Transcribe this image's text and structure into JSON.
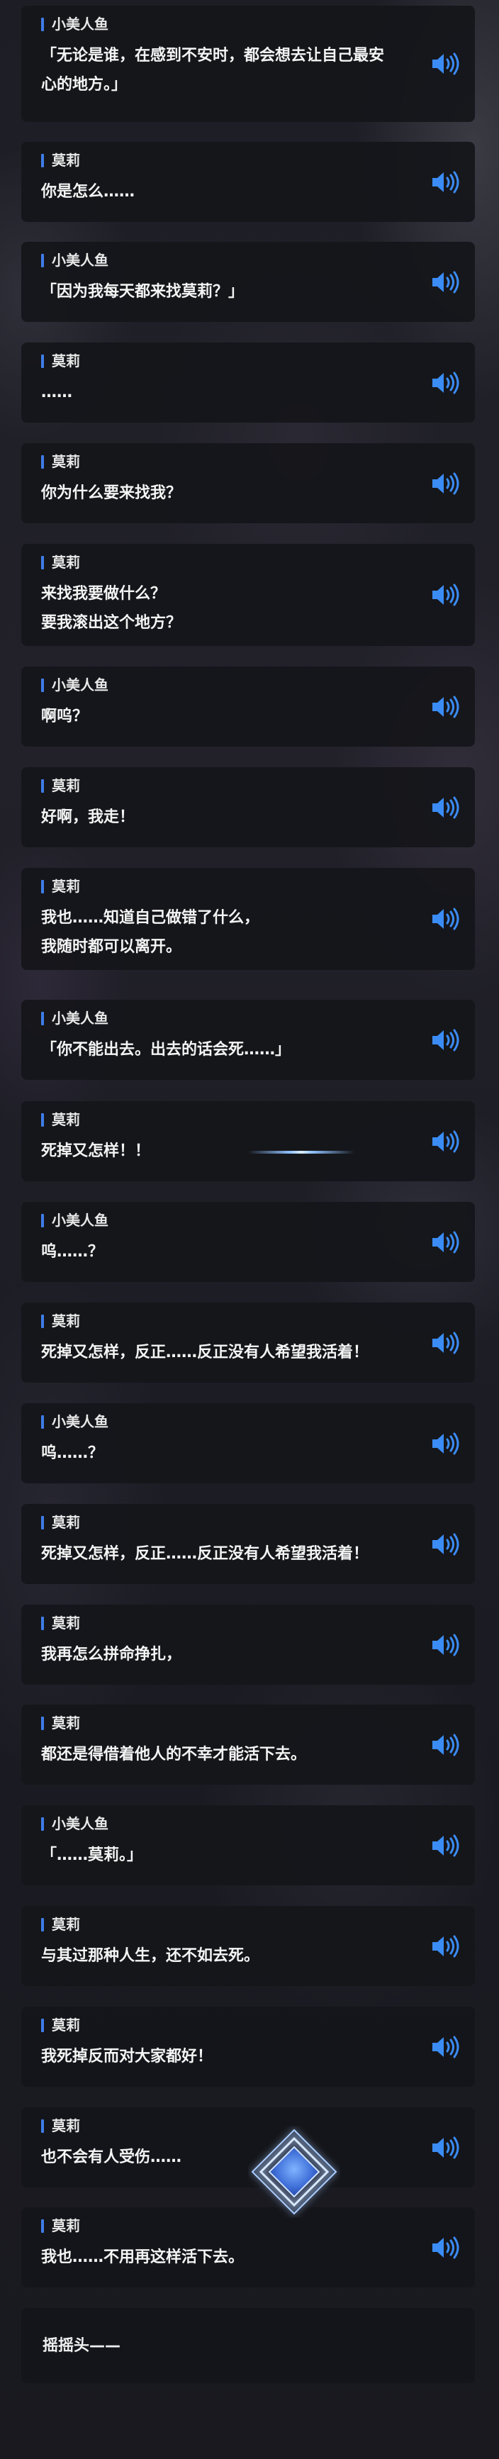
{
  "dialogue": [
    {
      "speaker": "小美人鱼",
      "lines": [
        "「无论是谁，在感到不安时，都会想去让自己最安",
        "心的地方。」"
      ]
    },
    {
      "speaker": "莫莉",
      "lines": [
        "你是怎么……"
      ]
    },
    {
      "speaker": "小美人鱼",
      "lines": [
        "「因为我每天都来找莫莉？」"
      ]
    },
    {
      "speaker": "莫莉",
      "lines": [
        "……"
      ]
    },
    {
      "speaker": "莫莉",
      "lines": [
        "你为什么要来找我？"
      ]
    },
    {
      "speaker": "莫莉",
      "lines": [
        "来找我要做什么？",
        "要我滚出这个地方？"
      ]
    },
    {
      "speaker": "小美人鱼",
      "lines": [
        "啊呜？"
      ]
    },
    {
      "speaker": "莫莉",
      "lines": [
        "好啊，我走！"
      ]
    },
    {
      "speaker": "莫莉",
      "lines": [
        "我也……知道自己做错了什么，",
        "我随时都可以离开。"
      ]
    },
    {
      "speaker": "小美人鱼",
      "lines": [
        "「你不能出去。出去的话会死……」"
      ]
    },
    {
      "speaker": "莫莉",
      "lines": [
        "死掉又怎样！！"
      ]
    },
    {
      "speaker": "小美人鱼",
      "lines": [
        "呜……？"
      ]
    },
    {
      "speaker": "莫莉",
      "lines": [
        "死掉又怎样，反正……反正没有人希望我活着！"
      ]
    },
    {
      "speaker": "小美人鱼",
      "lines": [
        "呜……？"
      ]
    },
    {
      "speaker": "莫莉",
      "lines": [
        "死掉又怎样，反正……反正没有人希望我活着！"
      ]
    },
    {
      "speaker": "莫莉",
      "lines": [
        "我再怎么拼命挣扎，"
      ]
    },
    {
      "speaker": "莫莉",
      "lines": [
        "都还是得借着他人的不幸才能活下去。"
      ]
    },
    {
      "speaker": "小美人鱼",
      "lines": [
        "「……莫莉。」"
      ]
    },
    {
      "speaker": "莫莉",
      "lines": [
        "与其过那种人生，还不如去死。"
      ]
    },
    {
      "speaker": "莫莉",
      "lines": [
        "我死掉反而对大家都好！"
      ]
    },
    {
      "speaker": "莫莉",
      "lines": [
        "也不会有人受伤……"
      ]
    },
    {
      "speaker": "莫莉",
      "lines": [
        "我也……不用再这样活下去。"
      ]
    }
  ],
  "narration": {
    "text": "摇摇头——"
  },
  "icons": {
    "speak": "speaker-volume-icon",
    "accent": "#3f7de8",
    "speaker_icon_color": "#3b8cf5"
  }
}
